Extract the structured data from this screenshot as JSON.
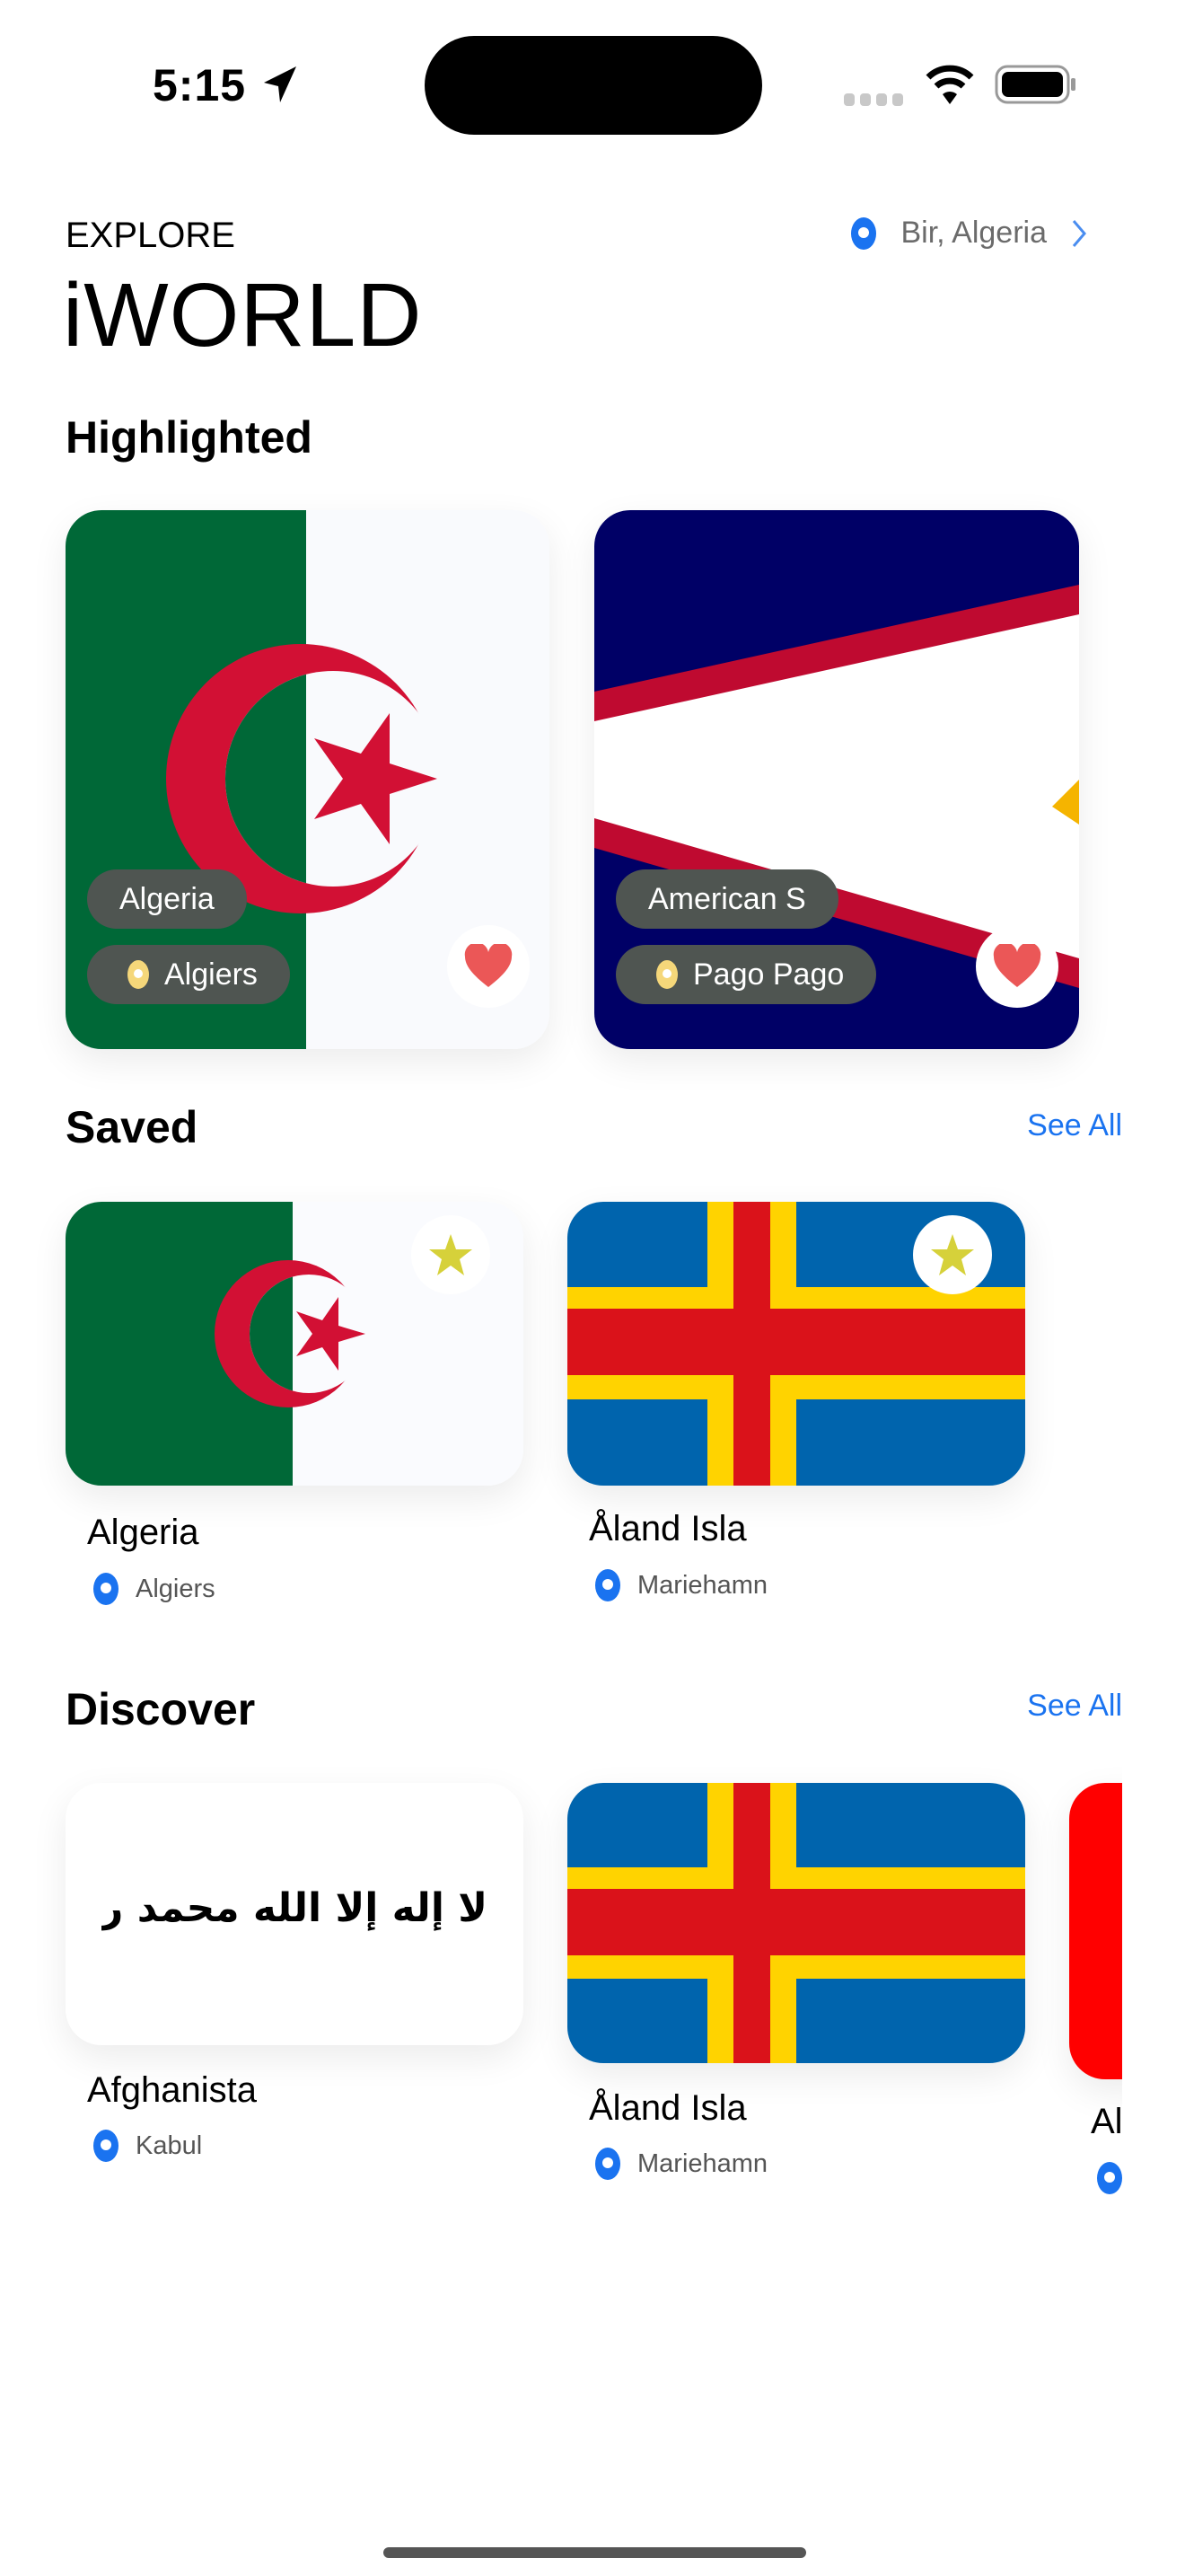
{
  "status_bar": {
    "time": "5:15"
  },
  "header": {
    "eyebrow": "EXPLORE",
    "title": "iWORLD",
    "location": "Bir, Algeria"
  },
  "highlighted": {
    "title": "Highlighted",
    "items": [
      {
        "country": "Algeria",
        "capital": "Algiers"
      },
      {
        "country": "American S",
        "capital": "Pago Pago"
      }
    ]
  },
  "saved": {
    "title": "Saved",
    "see_all": "See All",
    "items": [
      {
        "country": "Algeria",
        "capital": "Algiers"
      },
      {
        "country": "Åland Isla",
        "capital": "Mariehamn"
      }
    ]
  },
  "discover": {
    "title": "Discover",
    "see_all": "See All",
    "items": [
      {
        "country": "Afghanista",
        "capital": "Kabul",
        "flag_text": "لا إله إلا الله محمد رسول الله"
      },
      {
        "country": "Åland Isla",
        "capital": "Mariehamn"
      },
      {
        "country": "Al"
      }
    ]
  },
  "colors": {
    "accent": "#1a73f0",
    "heart": "#eb5757",
    "star": "#d6d13a",
    "pill": "#4f5551"
  }
}
